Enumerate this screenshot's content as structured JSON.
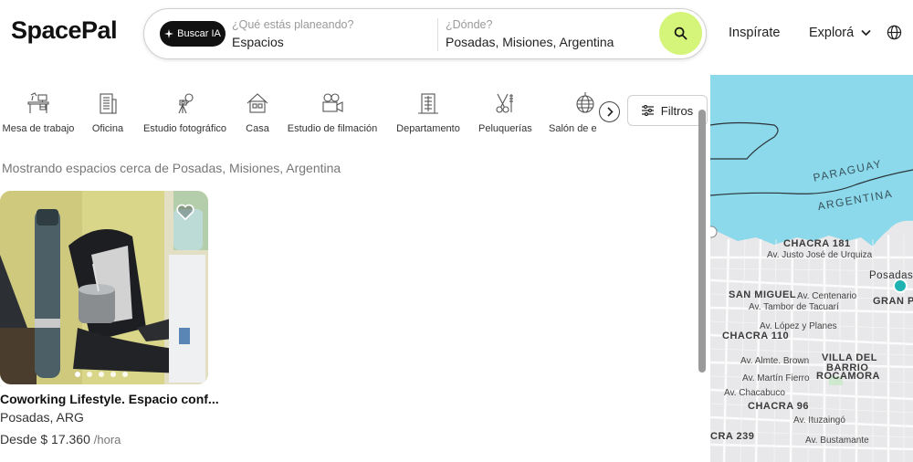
{
  "brand": {
    "logo": "SpacePal"
  },
  "search": {
    "ai_button": "Buscar IA",
    "what_label": "¿Qué estás planeando?",
    "what_value": "Espacios",
    "where_label": "¿Dónde?",
    "where_value": "Posadas, Misiones, Argentina"
  },
  "nav": {
    "inspirate": "Inspírate",
    "explora": "Explorá"
  },
  "categories": [
    {
      "label": "Mesa de trabajo",
      "icon": "desk-icon"
    },
    {
      "label": "Oficina",
      "icon": "office-building-icon"
    },
    {
      "label": "Estudio fotográfico",
      "icon": "photo-studio-icon"
    },
    {
      "label": "Casa",
      "icon": "house-icon"
    },
    {
      "label": "Estudio de filmación",
      "icon": "film-camera-icon"
    },
    {
      "label": "Departamento",
      "icon": "apartment-building-icon"
    },
    {
      "label": "Peluquerías",
      "icon": "scissors-icon"
    },
    {
      "label": "Salón de e",
      "icon": "disco-ball-icon"
    }
  ],
  "filters": {
    "label": "Filtros"
  },
  "results": {
    "note": "Mostrando espacios cerca de Posadas, Misiones, Argentina"
  },
  "listing": {
    "title": "Coworking Lifestyle. Espacio conf...",
    "location": "Posadas, ARG",
    "price": "Desde $ 17.360",
    "unit": "/hora",
    "photo_count": 5
  },
  "map": {
    "labels": {
      "paraguay": "PARAGUAY",
      "argentina": "ARGENTINA",
      "chacra181": "CHACRA 181",
      "justo": "Av. Justo José de Urquiza",
      "posadas": "Posadas",
      "sanmiguel": "SAN MIGUEL",
      "centenario": "Av. Centenario",
      "granpo": "GRAN PO",
      "tacuari": "Av. Tambor de Tacuarí",
      "lopez": "Av. López y Planes",
      "chacra110": "CHACRA 110",
      "brown": "Av. Almte. Brown",
      "villa1": "VILLA DEL",
      "villa2": "BARRIO",
      "villa3": "ROCAMORA",
      "fierro": "Av. Martín Fierro",
      "chacabuco": "Av. Chacabuco",
      "chacra96": "CHACRA 96",
      "ituzaingo": "Av. Ituzaingó",
      "chacra239": "CRA 239",
      "bustamante": "Av. Bustamante"
    },
    "colors": {
      "water": "#8bd9ea",
      "land": "#e8e8ea",
      "road": "#ffffff",
      "marker": "#1fb2b0"
    }
  },
  "colors": {
    "accent": "#d4f57a",
    "dark": "#111111"
  }
}
